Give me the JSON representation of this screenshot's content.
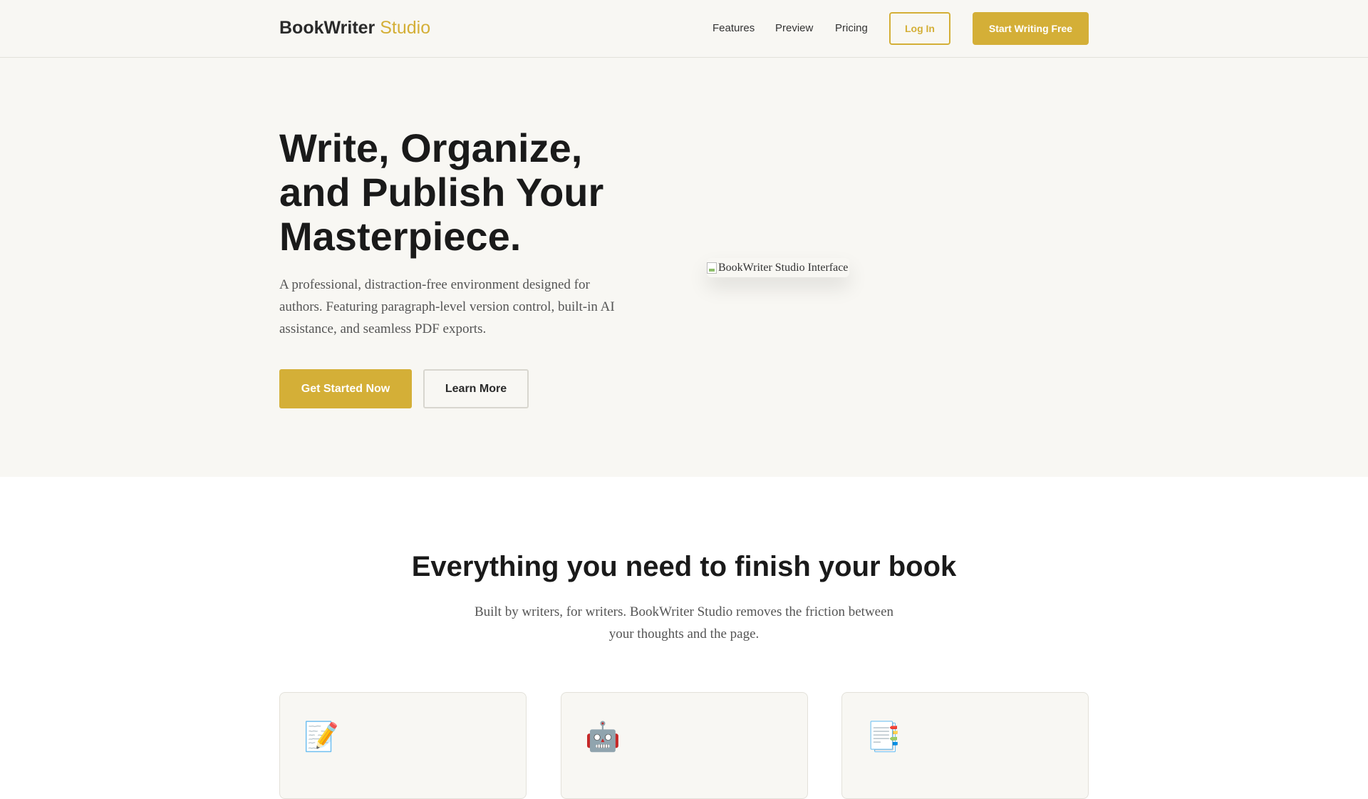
{
  "header": {
    "logo_main": "BookWriter",
    "logo_accent": "Studio",
    "nav": [
      "Features",
      "Preview",
      "Pricing"
    ],
    "login_label": "Log In",
    "start_label": "Start Writing Free"
  },
  "hero": {
    "title": "Write, Organize, and Publish Your Masterpiece.",
    "description": "A professional, distraction-free environment designed for authors. Featuring paragraph-level version control, built-in AI assistance, and seamless PDF exports.",
    "primary_button": "Get Started Now",
    "secondary_button": "Learn More",
    "image_alt": "BookWriter Studio Interface"
  },
  "features": {
    "title": "Everything you need to finish your book",
    "subtitle": "Built by writers, for writers. BookWriter Studio removes the friction between your thoughts and the page.",
    "cards": [
      {
        "icon": "📝",
        "icon_name": "memo-icon"
      },
      {
        "icon": "🤖",
        "icon_name": "robot-icon"
      },
      {
        "icon": "📑",
        "icon_name": "bookmark-tabs-icon"
      }
    ]
  },
  "colors": {
    "accent": "#d4af37",
    "background": "#f8f7f3"
  }
}
